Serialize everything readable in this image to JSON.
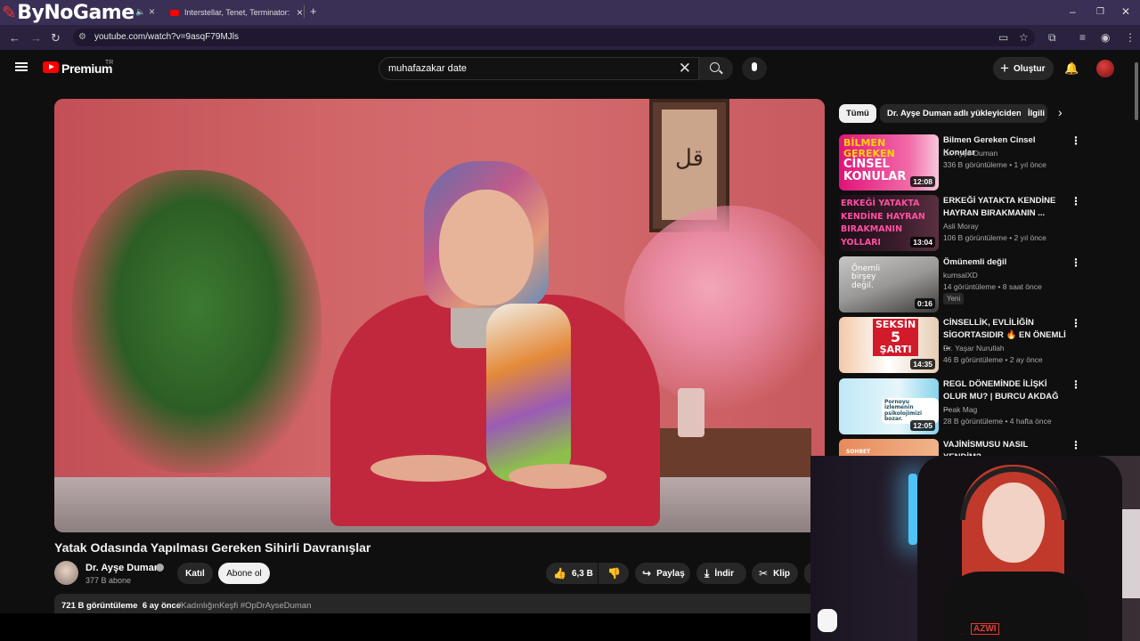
{
  "browser": {
    "brand": "ByNoGame",
    "tab_title": "Interstellar, Tenet, Terminator: I",
    "new_tab": "+",
    "url": "youtube.com/watch?v=9asqF79MJls"
  },
  "header": {
    "logo_text": "Premium",
    "country": "TR",
    "search_value": "muhafazakar date",
    "create_label": "Oluştur"
  },
  "video": {
    "title": "Yatak Odasında Yapılması Gereken Sihirli Davranışlar",
    "channel": "Dr. Ayşe Duman",
    "subscribers": "377 B abone",
    "join_label": "Katıl",
    "subscribe_label": "Abone ol",
    "likes": "6,3 B",
    "share_label": "Paylaş",
    "download_label": "İndir",
    "clip_label": "Klip",
    "views": "721 B görüntüleme",
    "age": "6 ay önce",
    "hashtags": "#KadınlığınKeşfi #OpDrAyseDuman",
    "frame_calligraphy": "قل"
  },
  "sidebar": {
    "chips": [
      "Tümü",
      "Dr. Ayşe Duman adlı yükleyiciden",
      "İlgili"
    ],
    "recommendations": [
      {
        "title": "Bilmen Gereken Cinsel Konular",
        "channel": "Dr. Ayşe Duman",
        "meta": "336 B görüntüleme • 1 yıl önce",
        "duration": "12:08",
        "thumb_text": [
          "BİLMEN",
          "GEREKEN",
          "CİNSEL",
          "KONULAR"
        ]
      },
      {
        "title": "ERKEĞİ YATAKTA KENDİNE HAYRAN BIRAKMANIN ...",
        "channel": "Asli Moray",
        "meta": "106 B görüntüleme • 2 yıl önce",
        "duration": "13:04",
        "thumb_text": [
          "ERKEĞİ YATAKTA",
          "KENDİNE HAYRAN",
          "BIRAKMANIN",
          "YOLLARI"
        ]
      },
      {
        "title": "Ömünemli değil",
        "channel": "kumsalXD",
        "meta": "14 görüntüleme • 8 saat önce",
        "duration": "0:16",
        "badge": "Yeni",
        "thumb_text": [
          "Önemli",
          "birşey",
          "değil."
        ]
      },
      {
        "title": "CİNSELLİK, EVLİLİĞİN SİGORTASIDIR 🔥 EN ÖNEMLİ ...",
        "channel": "Dr. Yaşar Nurullah",
        "meta": "46 B görüntüleme • 2 ay önce",
        "duration": "14:35",
        "thumb_text": [
          "SEKSİN",
          "5",
          "ŞARTI"
        ]
      },
      {
        "title": "REGL DÖNEMİNDE İLİŞKİ OLUR MU? | BURCU AKDAĞ ...",
        "channel": "Peak Mag",
        "meta": "28 B görüntüleme • 4 hafta önce",
        "duration": "12:05",
        "thumb_text": [
          "Pornoyu izlemenin",
          "psikolojimizi bozar."
        ]
      },
      {
        "title": "VAJİNİSMUSU NASIL YENDİM?",
        "channel": "",
        "meta": "",
        "duration": "",
        "thumb_text": [
          "SOHBET"
        ]
      }
    ]
  },
  "webcam": {
    "shirt_text": "AZWI"
  },
  "colors": {
    "bg": "#0f0f0f",
    "chrome_tabs": "#3a2f54",
    "chrome_address": "#2b2240",
    "yt_red": "#ff0000"
  }
}
